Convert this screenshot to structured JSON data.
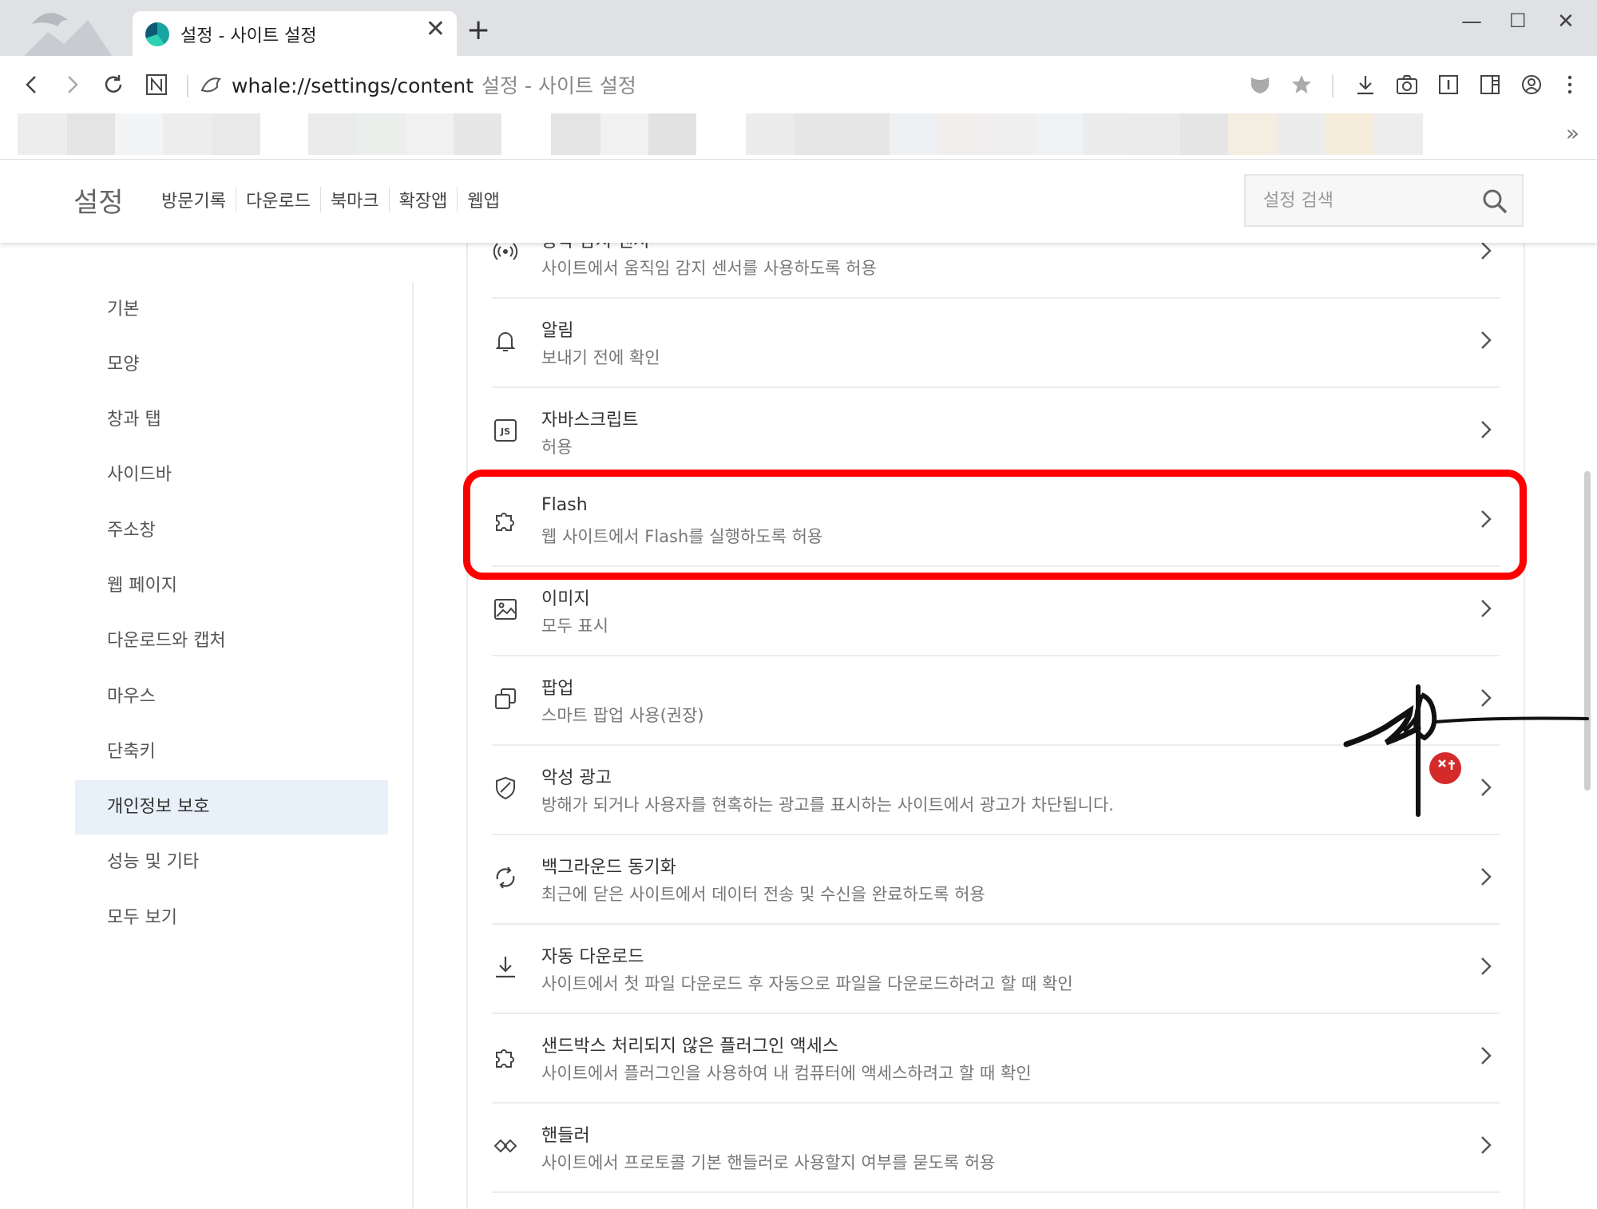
{
  "browser": {
    "tab_title": "설정 - 사이트 설정",
    "url": "whale://settings/content",
    "url_page_title": "설정 - 사이트 설정"
  },
  "settings": {
    "title": "설정",
    "topnav": [
      "방문기록",
      "다운로드",
      "북마크",
      "확장앱",
      "웹앱"
    ],
    "search_placeholder": "설정 검색"
  },
  "sidebar": {
    "items": [
      {
        "label": "기본"
      },
      {
        "label": "모양"
      },
      {
        "label": "창과 탭"
      },
      {
        "label": "사이드바"
      },
      {
        "label": "주소창"
      },
      {
        "label": "웹 페이지"
      },
      {
        "label": "다운로드와 캡처"
      },
      {
        "label": "마우스"
      },
      {
        "label": "단축키"
      },
      {
        "label": "개인정보 보호",
        "active": true
      },
      {
        "label": "성능 및 기타"
      },
      {
        "label": "모두 보기"
      }
    ]
  },
  "content_settings": [
    {
      "title": "동작 감지 센서",
      "subtitle": "사이트에서 움직임 감지 센서를 사용하도록 허용",
      "icon": "sensor-icon"
    },
    {
      "title": "알림",
      "subtitle": "보내기 전에 확인",
      "icon": "bell-icon"
    },
    {
      "title": "자바스크립트",
      "subtitle": "허용",
      "icon": "javascript-icon"
    },
    {
      "title": "Flash",
      "subtitle": "웹 사이트에서 Flash를 실행하도록 허용",
      "icon": "puzzle-icon",
      "highlighted": true
    },
    {
      "title": "이미지",
      "subtitle": "모두 표시",
      "icon": "image-icon"
    },
    {
      "title": "팝업",
      "subtitle": "스마트 팝업 사용(권장)",
      "icon": "popup-icon"
    },
    {
      "title": "악성 광고",
      "subtitle": "방해가 되거나 사용자를 현혹하는 광고를 표시하는 사이트에서 광고가 차단됩니다.",
      "icon": "shield-icon"
    },
    {
      "title": "백그라운드 동기화",
      "subtitle": "최근에 닫은 사이트에서 데이터 전송 및 수신을 완료하도록 허용",
      "icon": "sync-icon"
    },
    {
      "title": "자동 다운로드",
      "subtitle": "사이트에서 첫 파일 다운로드 후 자동으로 파일을 다운로드하려고 할 때 확인",
      "icon": "download-icon"
    },
    {
      "title": "샌드박스 처리되지 않은 플러그인 액세스",
      "subtitle": "사이트에서 플러그인을 사용하여 내 컴퓨터에 액세스하려고 할 때 확인",
      "icon": "puzzle-icon"
    },
    {
      "title": "핸들러",
      "subtitle": "사이트에서 프로토콜 기본 핸들러로 사용할지 여부를 묻도록 허용",
      "icon": "handler-icon"
    }
  ],
  "colors": {
    "highlight": "#ff0000",
    "active_sidebar": "#e8f1fa"
  }
}
